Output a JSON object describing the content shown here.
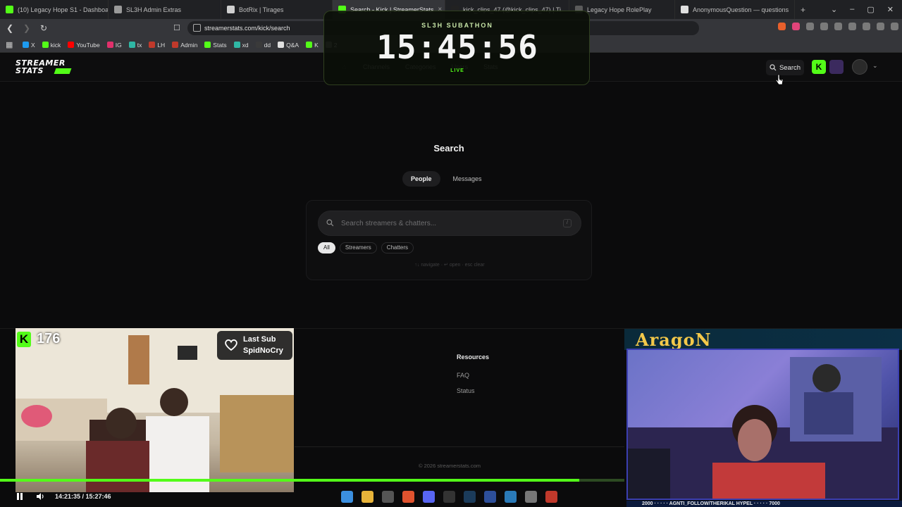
{
  "browser": {
    "tabs": [
      {
        "label": "(10) Legacy Hope S1 - Dashboard",
        "color": "#53fc18"
      },
      {
        "label": "SL3H Admin Extras",
        "color": "#9a9a9a"
      },
      {
        "label": "BotRix | Tirages",
        "color": "#d0d0d0"
      },
      {
        "label": "Search - Kick | StreamerStats",
        "color": "#53fc18"
      },
      {
        "label": "kick_clips_47 (@kick_clips_47) | Ti",
        "color": "#222222"
      },
      {
        "label": "Legacy Hope RolePlay",
        "color": "#5a5a5a"
      },
      {
        "label": "AnonymousQuestion — questions",
        "color": "#e0e0e0"
      }
    ],
    "active_tab_index": 3,
    "url": "streamerstats.com/kick/search",
    "bookmarks": [
      {
        "label": "X",
        "color": "#1d9bf0"
      },
      {
        "label": "kick",
        "color": "#53fc18"
      },
      {
        "label": "YouTube",
        "color": "#ff0000"
      },
      {
        "label": "IG",
        "color": "#e1306c"
      },
      {
        "label": "tx",
        "color": "#2fb7a5"
      },
      {
        "label": "LH",
        "color": "#c0392b"
      },
      {
        "label": "Admin",
        "color": "#c0392b"
      },
      {
        "label": "Stats",
        "color": "#53fc18"
      },
      {
        "label": "xd",
        "color": "#2fb7a5"
      },
      {
        "label": "dd",
        "color": "#3a3a3a"
      },
      {
        "label": "Q&A",
        "color": "#e0e0e0"
      },
      {
        "label": "K",
        "color": "#53fc18"
      },
      {
        "label": "2",
        "color": "#888888"
      }
    ]
  },
  "site": {
    "logo_line1": "STREAMER",
    "logo_line2": "STATS",
    "nav": [
      "Channels",
      "Categories",
      "Users",
      "Stats"
    ],
    "search_button_label": "Search",
    "page_title": "Search",
    "tabs": [
      "People",
      "Messages"
    ],
    "search_placeholder": "Search streamers & chatters...",
    "slash_key": "/",
    "filters": [
      "All",
      "Streamers",
      "Chatters"
    ],
    "hint": "↑↓ navigate · ↵ open · esc clear",
    "footer_heading": "Resources",
    "footer_links": [
      "FAQ",
      "Status"
    ],
    "copyright": "© 2026 streamerstats.com"
  },
  "overlay": {
    "subathon_title": "SL3H SUBATHON",
    "timer": "15:45:56",
    "live_label": "LIVE",
    "viewer_count": "176",
    "last_sub_label": "Last Sub",
    "last_sub_name": "SpidNoCry",
    "streamer_name": "AragoN",
    "ticker_text": "2000 · · · · · AGNTI_FOLLOW/THERIKAL HYPEL · · · · · 7000"
  },
  "player": {
    "time": "14:21:35 / 15:27:46",
    "progress_fraction": 0.928
  },
  "colors": {
    "kick_green": "#53fc18",
    "background": "#0b0b0c"
  }
}
